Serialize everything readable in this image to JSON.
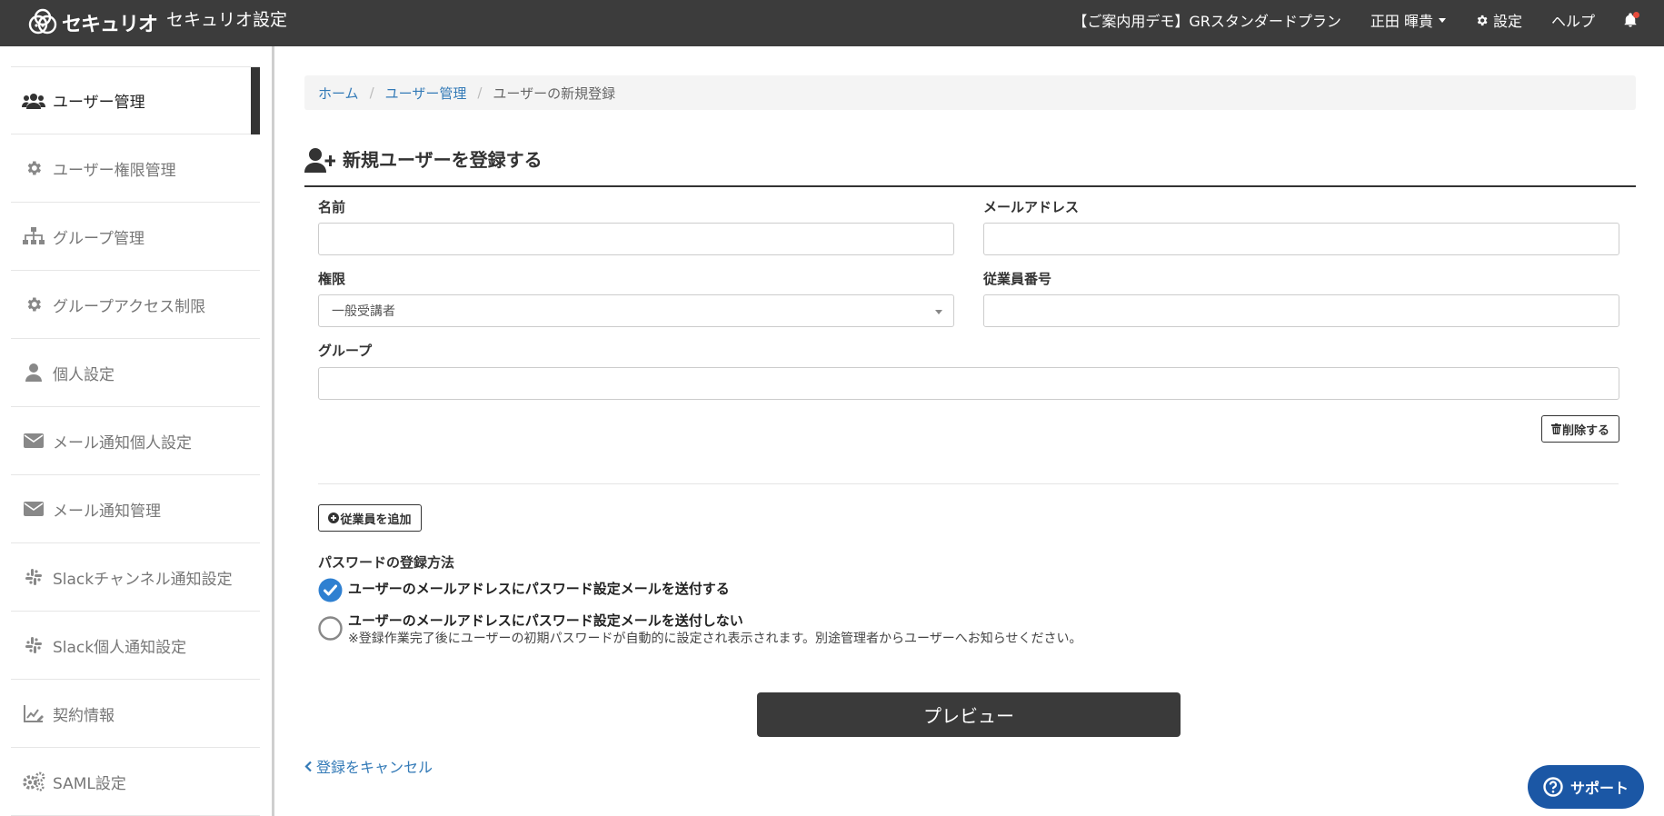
{
  "header": {
    "logo_text": "セキュリオ",
    "app_title": "セキュリオ設定",
    "plan": "【ご案内用デモ】GRスタンダードプラン",
    "user_name": "正田 暉貴",
    "settings_label": "設定",
    "help_label": "ヘルプ"
  },
  "sidebar": {
    "items": [
      {
        "label": "ユーザー管理",
        "icon": "users-icon"
      },
      {
        "label": "ユーザー権限管理",
        "icon": "gear-icon"
      },
      {
        "label": "グループ管理",
        "icon": "sitemap-icon"
      },
      {
        "label": "グループアクセス制限",
        "icon": "gear-icon"
      },
      {
        "label": "個人設定",
        "icon": "user-icon"
      },
      {
        "label": "メール通知個人設定",
        "icon": "envelope-icon"
      },
      {
        "label": "メール通知管理",
        "icon": "envelope-icon"
      },
      {
        "label": "Slackチャンネル通知設定",
        "icon": "slack-icon"
      },
      {
        "label": "Slack個人通知設定",
        "icon": "slack-icon"
      },
      {
        "label": "契約情報",
        "icon": "chart-edit-icon"
      },
      {
        "label": "SAML設定",
        "icon": "gears-icon"
      }
    ]
  },
  "breadcrumb": {
    "home": "ホーム",
    "parent": "ユーザー管理",
    "current": "ユーザーの新規登録",
    "separator": "/"
  },
  "page": {
    "title": "新規ユーザーを登録する"
  },
  "form": {
    "name_label": "名前",
    "name_value": "",
    "email_label": "メールアドレス",
    "email_value": "",
    "role_label": "権限",
    "role_selected": "一般受講者",
    "employee_no_label": "従業員番号",
    "employee_no_value": "",
    "group_label": "グループ",
    "group_value": "",
    "delete_button": "削除する",
    "add_employee_button": "従業員を追加",
    "password_method_label": "パスワードの登録方法",
    "password_options": [
      {
        "label": "ユーザーのメールアドレスにパスワード設定メールを送付する",
        "checked": true
      },
      {
        "label": "ユーザーのメールアドレスにパスワード設定メールを送付しない",
        "checked": false,
        "note": "※登録作業完了後にユーザーの初期パスワードが自動的に設定され表示されます。別途管理者からユーザーへお知らせください。"
      }
    ],
    "preview_button": "プレビュー",
    "cancel_link": "登録をキャンセル"
  },
  "support": {
    "label": "サポート"
  },
  "colors": {
    "header_bg": "#3c3c3c",
    "link": "#337ab7",
    "radio_checked": "#2f80d1",
    "support_bg": "#1b57a5",
    "preview_bg": "#3a3a3a"
  }
}
